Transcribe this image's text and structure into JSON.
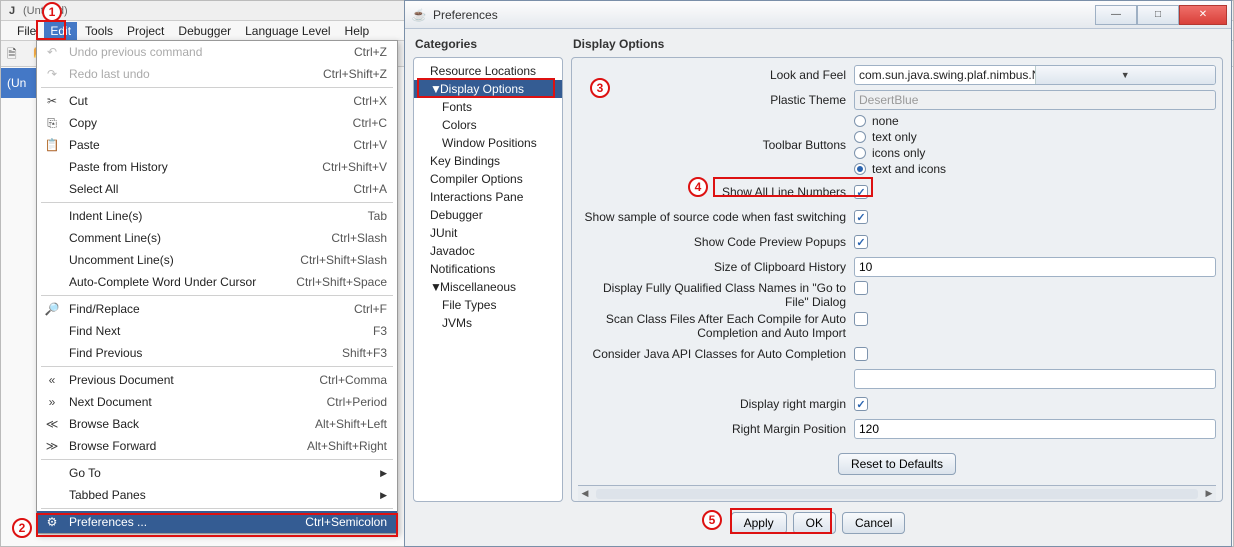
{
  "ide": {
    "title": "(Untitled)",
    "gutter": "(Un",
    "menus": [
      "File",
      "Edit",
      "Tools",
      "Project",
      "Debugger",
      "Language Level",
      "Help"
    ],
    "active_menu_index": 1
  },
  "editMenu": {
    "groups": [
      {
        "items": [
          {
            "icon": "undo",
            "label": "Undo previous command",
            "accel": "Ctrl+Z",
            "disabled": true
          },
          {
            "icon": "redo",
            "label": "Redo last undo",
            "accel": "Ctrl+Shift+Z",
            "disabled": true
          }
        ]
      },
      {
        "items": [
          {
            "icon": "cut",
            "label": "Cut",
            "accel": "Ctrl+X"
          },
          {
            "icon": "copy",
            "label": "Copy",
            "accel": "Ctrl+C"
          },
          {
            "icon": "paste",
            "label": "Paste",
            "accel": "Ctrl+V"
          },
          {
            "icon": "",
            "label": "Paste from History",
            "accel": "Ctrl+Shift+V"
          },
          {
            "icon": "",
            "label": "Select All",
            "accel": "Ctrl+A"
          }
        ]
      },
      {
        "items": [
          {
            "icon": "",
            "label": "Indent Line(s)",
            "accel": "Tab"
          },
          {
            "icon": "",
            "label": "Comment Line(s)",
            "accel": "Ctrl+Slash"
          },
          {
            "icon": "",
            "label": "Uncomment Line(s)",
            "accel": "Ctrl+Shift+Slash"
          },
          {
            "icon": "",
            "label": "Auto-Complete Word Under Cursor",
            "accel": "Ctrl+Shift+Space"
          }
        ]
      },
      {
        "items": [
          {
            "icon": "find",
            "label": "Find/Replace",
            "accel": "Ctrl+F"
          },
          {
            "icon": "",
            "label": "Find Next",
            "accel": "F3"
          },
          {
            "icon": "",
            "label": "Find Previous",
            "accel": "Shift+F3"
          }
        ]
      },
      {
        "items": [
          {
            "icon": "prev",
            "label": "Previous Document",
            "accel": "Ctrl+Comma"
          },
          {
            "icon": "next",
            "label": "Next Document",
            "accel": "Ctrl+Period"
          },
          {
            "icon": "back",
            "label": "Browse Back",
            "accel": "Alt+Shift+Left"
          },
          {
            "icon": "fwd",
            "label": "Browse Forward",
            "accel": "Alt+Shift+Right"
          }
        ]
      },
      {
        "items": [
          {
            "icon": "",
            "label": "Go To",
            "accel": "",
            "submenu": true
          },
          {
            "icon": "",
            "label": "Tabbed Panes",
            "accel": "",
            "submenu": true
          }
        ]
      },
      {
        "items": [
          {
            "icon": "prefs",
            "label": "Preferences ...",
            "accel": "Ctrl+Semicolon",
            "highlight": true
          }
        ]
      }
    ]
  },
  "prefDialog": {
    "title": "Preferences",
    "categoriesHeader": "Categories",
    "optionsHeader": "Display Options",
    "tree": [
      {
        "label": "Resource Locations"
      },
      {
        "label": "Display Options",
        "selected": true,
        "expanded": true,
        "children": [
          {
            "label": "Fonts"
          },
          {
            "label": "Colors"
          },
          {
            "label": "Window Positions"
          }
        ]
      },
      {
        "label": "Key Bindings"
      },
      {
        "label": "Compiler Options"
      },
      {
        "label": "Interactions Pane"
      },
      {
        "label": "Debugger"
      },
      {
        "label": "JUnit"
      },
      {
        "label": "Javadoc"
      },
      {
        "label": "Notifications"
      },
      {
        "label": "Miscellaneous",
        "expanded": true,
        "children": [
          {
            "label": "File Types"
          },
          {
            "label": "JVMs"
          }
        ]
      }
    ],
    "options": {
      "lookAndFeel": {
        "label": "Look and Feel",
        "value": "com.sun.java.swing.plaf.nimbus.NimbusLookAndFeel"
      },
      "plasticTheme": {
        "label": "Plastic Theme",
        "value": "DesertBlue",
        "disabled": true
      },
      "toolbarButtons": {
        "label": "Toolbar Buttons",
        "choices": [
          "none",
          "text only",
          "icons only",
          "text and icons"
        ],
        "selected": 3
      },
      "showLineNumbers": {
        "label": "Show All Line Numbers",
        "checked": true
      },
      "fastSwitch": {
        "label": "Show sample of source code when fast switching",
        "checked": true
      },
      "previewPopups": {
        "label": "Show Code Preview Popups",
        "checked": true
      },
      "clipHistory": {
        "label": "Size of Clipboard History",
        "value": "10"
      },
      "fqnGoToFile": {
        "label": "Display Fully Qualified Class Names in \"Go to File\" Dialog",
        "checked": false
      },
      "scanAfterCompile": {
        "label": "Scan Class Files After Each Compile for Auto Completion and Auto Import",
        "checked": false
      },
      "considerJavaApi": {
        "label": "Consider Java API Classes for Auto Completion",
        "checked": false
      },
      "extraPkgs": {
        "label": "",
        "value": ""
      },
      "rightMargin": {
        "label": "Display right margin",
        "checked": true
      },
      "rightMarginPos": {
        "label": "Right Margin Position",
        "value": "120"
      },
      "reset": "Reset to Defaults"
    },
    "buttons": {
      "apply": "Apply",
      "ok": "OK",
      "cancel": "Cancel"
    }
  },
  "callouts": {
    "c1": "1",
    "c2": "2",
    "c3": "3",
    "c4": "4",
    "c5": "5"
  }
}
